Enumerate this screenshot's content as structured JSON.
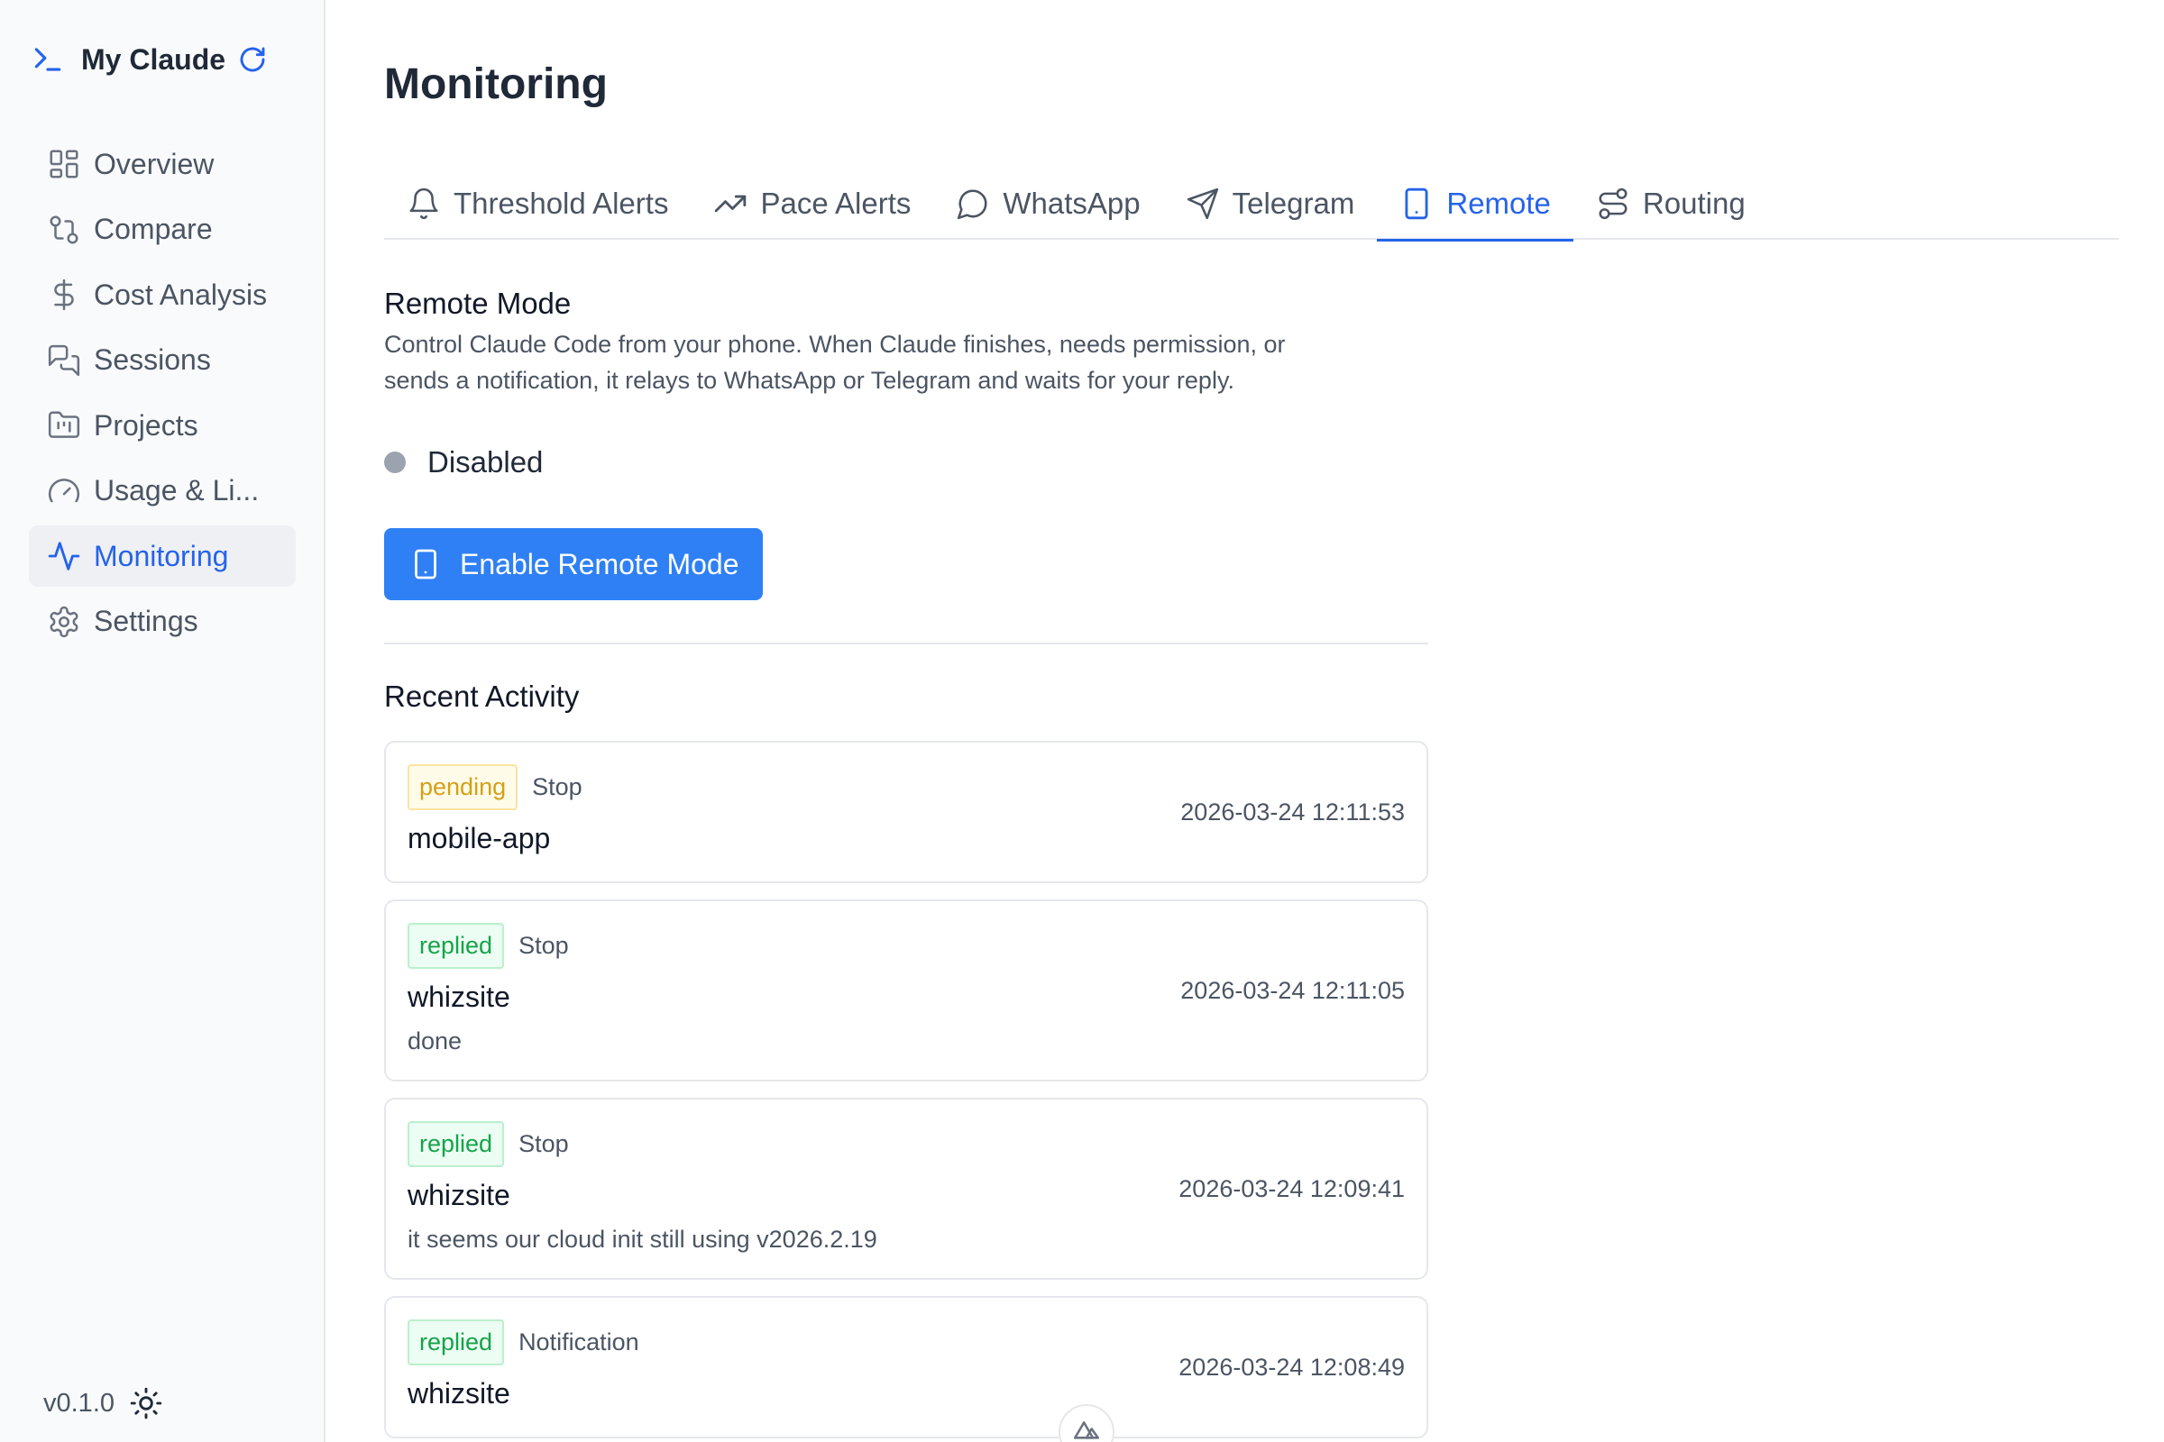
{
  "app": {
    "name": "My Claude",
    "version": "v0.1.0"
  },
  "sidebar": {
    "items": [
      {
        "label": "Overview",
        "icon": "grid-icon",
        "active": false
      },
      {
        "label": "Compare",
        "icon": "git-compare-icon",
        "active": false
      },
      {
        "label": "Cost Analysis",
        "icon": "dollar-icon",
        "active": false
      },
      {
        "label": "Sessions",
        "icon": "chat-bubbles-icon",
        "active": false
      },
      {
        "label": "Projects",
        "icon": "folder-kanban-icon",
        "active": false
      },
      {
        "label": "Usage & Li...",
        "icon": "gauge-icon",
        "active": false
      },
      {
        "label": "Monitoring",
        "icon": "activity-icon",
        "active": true
      },
      {
        "label": "Settings",
        "icon": "gear-icon",
        "active": false
      }
    ]
  },
  "page": {
    "title": "Monitoring"
  },
  "tabs": [
    {
      "label": "Threshold Alerts",
      "icon": "bell-icon",
      "active": false
    },
    {
      "label": "Pace Alerts",
      "icon": "trending-up-icon",
      "active": false
    },
    {
      "label": "WhatsApp",
      "icon": "message-circle-icon",
      "active": false
    },
    {
      "label": "Telegram",
      "icon": "send-icon",
      "active": false
    },
    {
      "label": "Remote",
      "icon": "smartphone-icon",
      "active": true
    },
    {
      "label": "Routing",
      "icon": "route-icon",
      "active": false
    }
  ],
  "remote": {
    "title": "Remote Mode",
    "description_line1": "Control Claude Code from your phone. When Claude finishes, needs permission, or",
    "description_line2": "sends a notification, it relays to WhatsApp or Telegram and waits for your reply.",
    "status": "Disabled",
    "enable_button": "Enable Remote Mode"
  },
  "activity": {
    "title": "Recent Activity",
    "items": [
      {
        "status": "pending",
        "kind": "Stop",
        "project": "mobile-app",
        "message": "",
        "timestamp": "2026-03-24 12:11:53"
      },
      {
        "status": "replied",
        "kind": "Stop",
        "project": "whizsite",
        "message": "done",
        "timestamp": "2026-03-24 12:11:05"
      },
      {
        "status": "replied",
        "kind": "Stop",
        "project": "whizsite",
        "message": "it seems our cloud init still using v2026.2.19",
        "timestamp": "2026-03-24 12:09:41"
      },
      {
        "status": "replied",
        "kind": "Notification",
        "project": "whizsite",
        "message": "",
        "timestamp": "2026-03-24 12:08:49"
      }
    ]
  },
  "colors": {
    "accent": "#2563eb",
    "button": "#2f80f5",
    "pending": "#d4a017",
    "replied": "#16a34a",
    "disabled_dot": "#9ca3af"
  }
}
